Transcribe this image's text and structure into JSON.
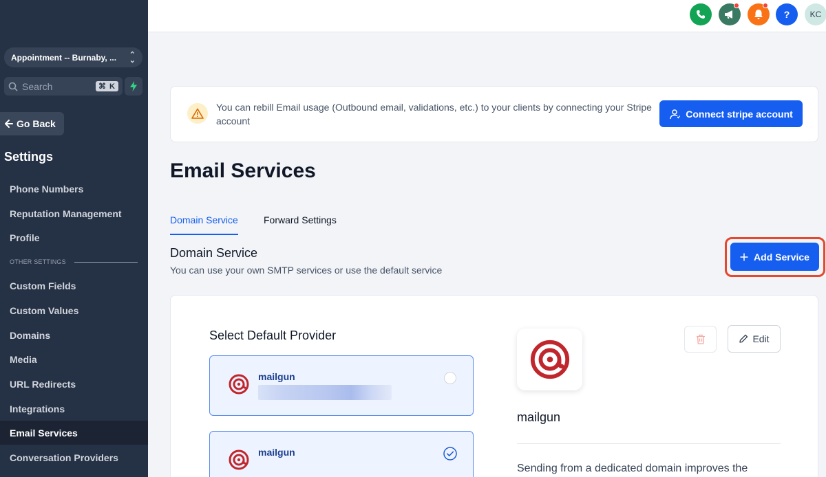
{
  "sidebar": {
    "location": "Appointment -- Burnaby, ...",
    "search_placeholder": "Search",
    "search_shortcut": "⌘ K",
    "go_back": "Go Back",
    "settings_title": "Settings",
    "items": [
      {
        "label": "Phone Numbers"
      },
      {
        "label": "Reputation Management"
      },
      {
        "label": "Profile"
      }
    ],
    "other_settings_label": "OTHER SETTINGS",
    "other_items": [
      {
        "label": "Custom Fields"
      },
      {
        "label": "Custom Values"
      },
      {
        "label": "Domains"
      },
      {
        "label": "Media"
      },
      {
        "label": "URL Redirects"
      },
      {
        "label": "Integrations"
      },
      {
        "label": "Email Services",
        "active": true
      },
      {
        "label": "Conversation Providers"
      }
    ]
  },
  "topbar": {
    "icons": [
      {
        "name": "phone-icon",
        "color": "#12a454"
      },
      {
        "name": "megaphone-icon",
        "color": "#3b7a62"
      },
      {
        "name": "bell-icon",
        "color": "#f97316"
      },
      {
        "name": "help-icon",
        "color": "#155eef"
      }
    ],
    "avatar_initials": "KC"
  },
  "banner": {
    "text": "You can rebill Email usage (Outbound email, validations, etc.) to your clients by connecting your Stripe account",
    "button_label": "Connect stripe account"
  },
  "page": {
    "title": "Email Services",
    "tabs": [
      {
        "label": "Domain Service",
        "active": true
      },
      {
        "label": "Forward Settings",
        "active": false
      }
    ],
    "section_title": "Domain Service",
    "section_description": "You can use your own SMTP services or use the default service",
    "add_button_label": "Add Service"
  },
  "providers_card": {
    "select_title": "Select Default Provider",
    "providers": [
      {
        "name": "mailgun",
        "selected": false
      },
      {
        "name": "mailgun",
        "selected": true
      }
    ],
    "detail": {
      "name": "mailgun",
      "edit_label": "Edit",
      "description": "Sending from a dedicated domain improves the"
    }
  },
  "colors": {
    "sidebar_bg": "#253144",
    "primary": "#155eef",
    "highlight": "#e5482d",
    "mailgun_red": "#c0272d"
  }
}
